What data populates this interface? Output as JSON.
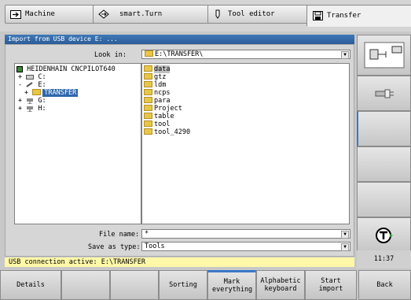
{
  "tabs": [
    {
      "label": "Machine",
      "icon": "machine-arrow-icon"
    },
    {
      "label": "smart.Turn",
      "icon": "smart-turn-icon"
    },
    {
      "label": "Tool editor",
      "icon": "tool-editor-icon"
    },
    {
      "label": "Transfer",
      "icon": "transfer-icon"
    }
  ],
  "dialog": {
    "title": "Import from USB device E: ...",
    "look_in_label": "Look in:",
    "look_in_value": "E:\\TRANSFER\\",
    "file_name_label": "File name:",
    "file_name_value": "*",
    "save_type_label": "Save as type:",
    "save_type_value": "Tools"
  },
  "tree": [
    {
      "label": "HEIDENHAIN CNCPILOT640",
      "expander": ""
    },
    {
      "label": "C:",
      "expander": "+"
    },
    {
      "label": "E:",
      "expander": "-"
    },
    {
      "label": "TRANSFER",
      "expander": "+"
    },
    {
      "label": "G:",
      "expander": "+"
    },
    {
      "label": "H:",
      "expander": "+"
    }
  ],
  "files": [
    "data",
    "gtz",
    "ldm",
    "ncps",
    "para",
    "Project",
    "table",
    "tool",
    "tool_4290"
  ],
  "status": "USB connection active: E:\\TRANSFER",
  "clock": "11:37",
  "softkeys": [
    {
      "label": "Details"
    },
    {
      "label": ""
    },
    {
      "label": ""
    },
    {
      "label": "Sorting"
    },
    {
      "label": "Mark everything"
    },
    {
      "label": "Alphabetic keyboard"
    },
    {
      "label": "Start import"
    },
    {
      "label": "Back"
    }
  ],
  "colors": {
    "title_bar": "#2f66ad",
    "status_bg": "#fff8a8",
    "accent": "#2f66ad"
  }
}
